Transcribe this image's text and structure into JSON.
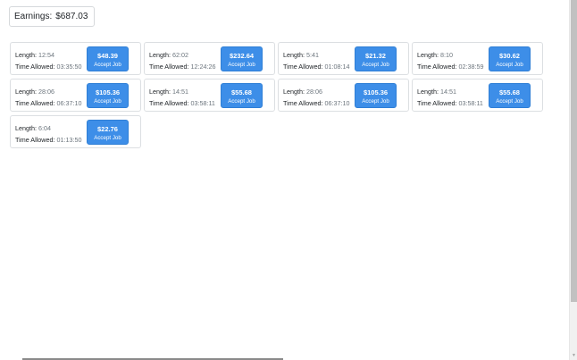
{
  "earnings": {
    "label": "Earnings:",
    "value": "$687.03"
  },
  "jobs": [
    {
      "length_label": "Length:",
      "length": "12:54",
      "time_label": "Time Allowed:",
      "time_allowed": "03:35:50",
      "price": "$48.39",
      "button": "Accept Job"
    },
    {
      "length_label": "Length:",
      "length": "62:02",
      "time_label": "Time Allowed:",
      "time_allowed": "12:24:26",
      "price": "$232.64",
      "button": "Accept Job"
    },
    {
      "length_label": "Length:",
      "length": "5:41",
      "time_label": "Time Allowed:",
      "time_allowed": "01:08:14",
      "price": "$21.32",
      "button": "Accept Job"
    },
    {
      "length_label": "Length:",
      "length": "8:10",
      "time_label": "Time Allowed:",
      "time_allowed": "02:38:59",
      "price": "$30.62",
      "button": "Accept Job"
    },
    {
      "length_label": "Length:",
      "length": "28:06",
      "time_label": "Time Allowed:",
      "time_allowed": "06:37:10",
      "price": "$105.36",
      "button": "Accept Job"
    },
    {
      "length_label": "Length:",
      "length": "14:51",
      "time_label": "Time Allowed:",
      "time_allowed": "03:58:11",
      "price": "$55.68",
      "button": "Accept Job"
    },
    {
      "length_label": "Length:",
      "length": "28:06",
      "time_label": "Time Allowed:",
      "time_allowed": "06:37:10",
      "price": "$105.36",
      "button": "Accept Job"
    },
    {
      "length_label": "Length:",
      "length": "14:51",
      "time_label": "Time Allowed:",
      "time_allowed": "03:58:11",
      "price": "$55.68",
      "button": "Accept Job"
    },
    {
      "length_label": "Length:",
      "length": "6:04",
      "time_label": "Time Allowed:",
      "time_allowed": "01:13:50",
      "price": "$22.76",
      "button": "Accept Job"
    }
  ],
  "scrollbar": {
    "arrow_icon": "scroll-down-arrow-icon"
  }
}
